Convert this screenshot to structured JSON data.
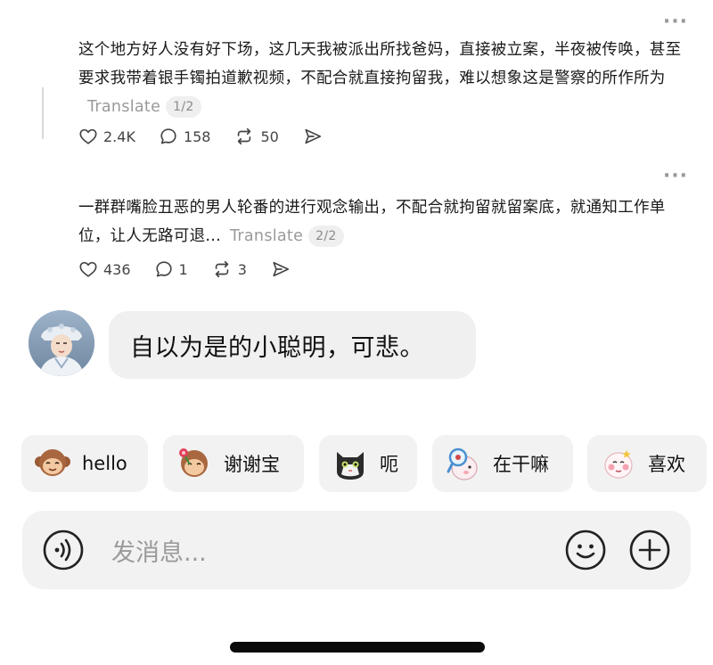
{
  "posts": [
    {
      "text": "这个地方好人没有好下场，这几天我被派出所找爸妈，直接被立案，半夜被传唤，甚至要求我带着银手镯拍道歉视频，不配合就直接拘留我，难以想象这是警察的所作所为",
      "translate_label": "Translate",
      "page": "1/2",
      "likes": "2.4K",
      "comments": "158",
      "reposts": "50"
    },
    {
      "text": "一群群嘴脸丑恶的男人轮番的进行观念输出，不配合就拘留就留案底，就通知工作单位，让人无路可退...",
      "translate_label": "Translate",
      "page": "2/2",
      "likes": "436",
      "comments": "1",
      "reposts": "3"
    }
  ],
  "reply": {
    "text": "自以为是的小聪明，可悲。"
  },
  "quick_replies": [
    {
      "label": "hello",
      "sticker": "monkey-sticker"
    },
    {
      "label": "谢谢宝",
      "sticker": "monkey-flower-sticker"
    },
    {
      "label": "呃",
      "sticker": "cat-sticker"
    },
    {
      "label": "在干嘛",
      "sticker": "magnifier-sticker"
    },
    {
      "label": "喜欢",
      "sticker": "blush-sticker"
    }
  ],
  "input": {
    "placeholder": "发消息..."
  },
  "colors": {
    "chip_bg": "#f2f2f2",
    "muted": "#9a9a9a"
  }
}
